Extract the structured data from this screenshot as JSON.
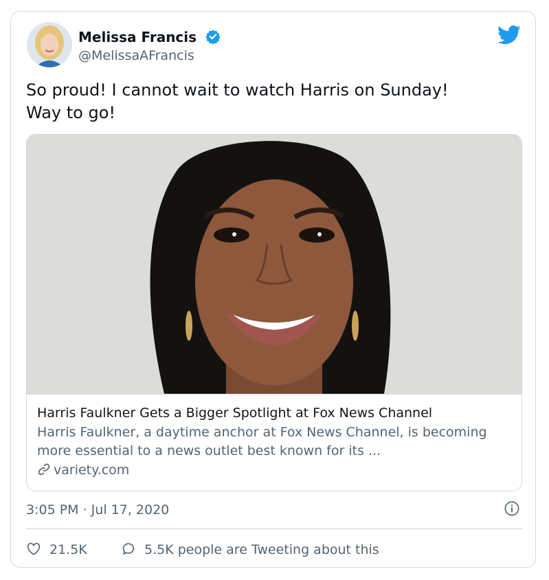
{
  "author": {
    "name": "Melissa Francis",
    "handle": "@MelissaAFrancis",
    "verified": true,
    "avatar_icon": "profile-photo"
  },
  "tweet": {
    "text": "So proud! I cannot wait to watch Harris on Sunday!\nWay to go!",
    "timestamp": "3:05 PM · Jul 17, 2020"
  },
  "card": {
    "image_icon": "portrait-photo",
    "title": "Harris Faulkner Gets a Bigger Spotlight at Fox News Channel",
    "description": "Harris Faulkner, a daytime anchor at Fox News Channel, is becoming more essential to a news outlet best known for its ...",
    "domain": "variety.com"
  },
  "actions": {
    "likes": "21.5K",
    "tweeting": "5.5K people are Tweeting about this"
  },
  "colors": {
    "accent": "#1d9bf0",
    "secondary_text": "#536471",
    "border": "#cfd9de"
  }
}
